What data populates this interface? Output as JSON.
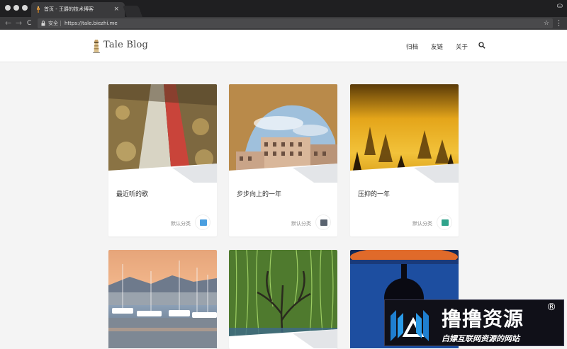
{
  "browser": {
    "tab_title": "首页 - 王爵的技术博客",
    "tab_close": "×",
    "secure_label": "安全",
    "url": "https://tale.biezhi.me",
    "back": "←",
    "forward": "→",
    "reload": "C",
    "star": "☆",
    "menu": "⋮",
    "incognito": "⛀"
  },
  "site": {
    "logo_text": "Tale Blog",
    "nav": [
      "归档",
      "友链",
      "关于"
    ]
  },
  "posts": [
    {
      "title": "最近听的歌",
      "category": "默认分类",
      "badge_color": "#4b9fe0"
    },
    {
      "title": "步步向上的一年",
      "category": "默认分类",
      "badge_color": "#5a6470"
    },
    {
      "title": "压抑的一年",
      "category": "默认分类",
      "badge_color": "#2fa38b"
    },
    {
      "title": "",
      "category": ""
    },
    {
      "title": "",
      "category": ""
    },
    {
      "title": "",
      "category": ""
    }
  ],
  "watermark": {
    "title": "撸撸资源",
    "reg": "®",
    "subtitle": "白嫖互联网资源的网站"
  }
}
